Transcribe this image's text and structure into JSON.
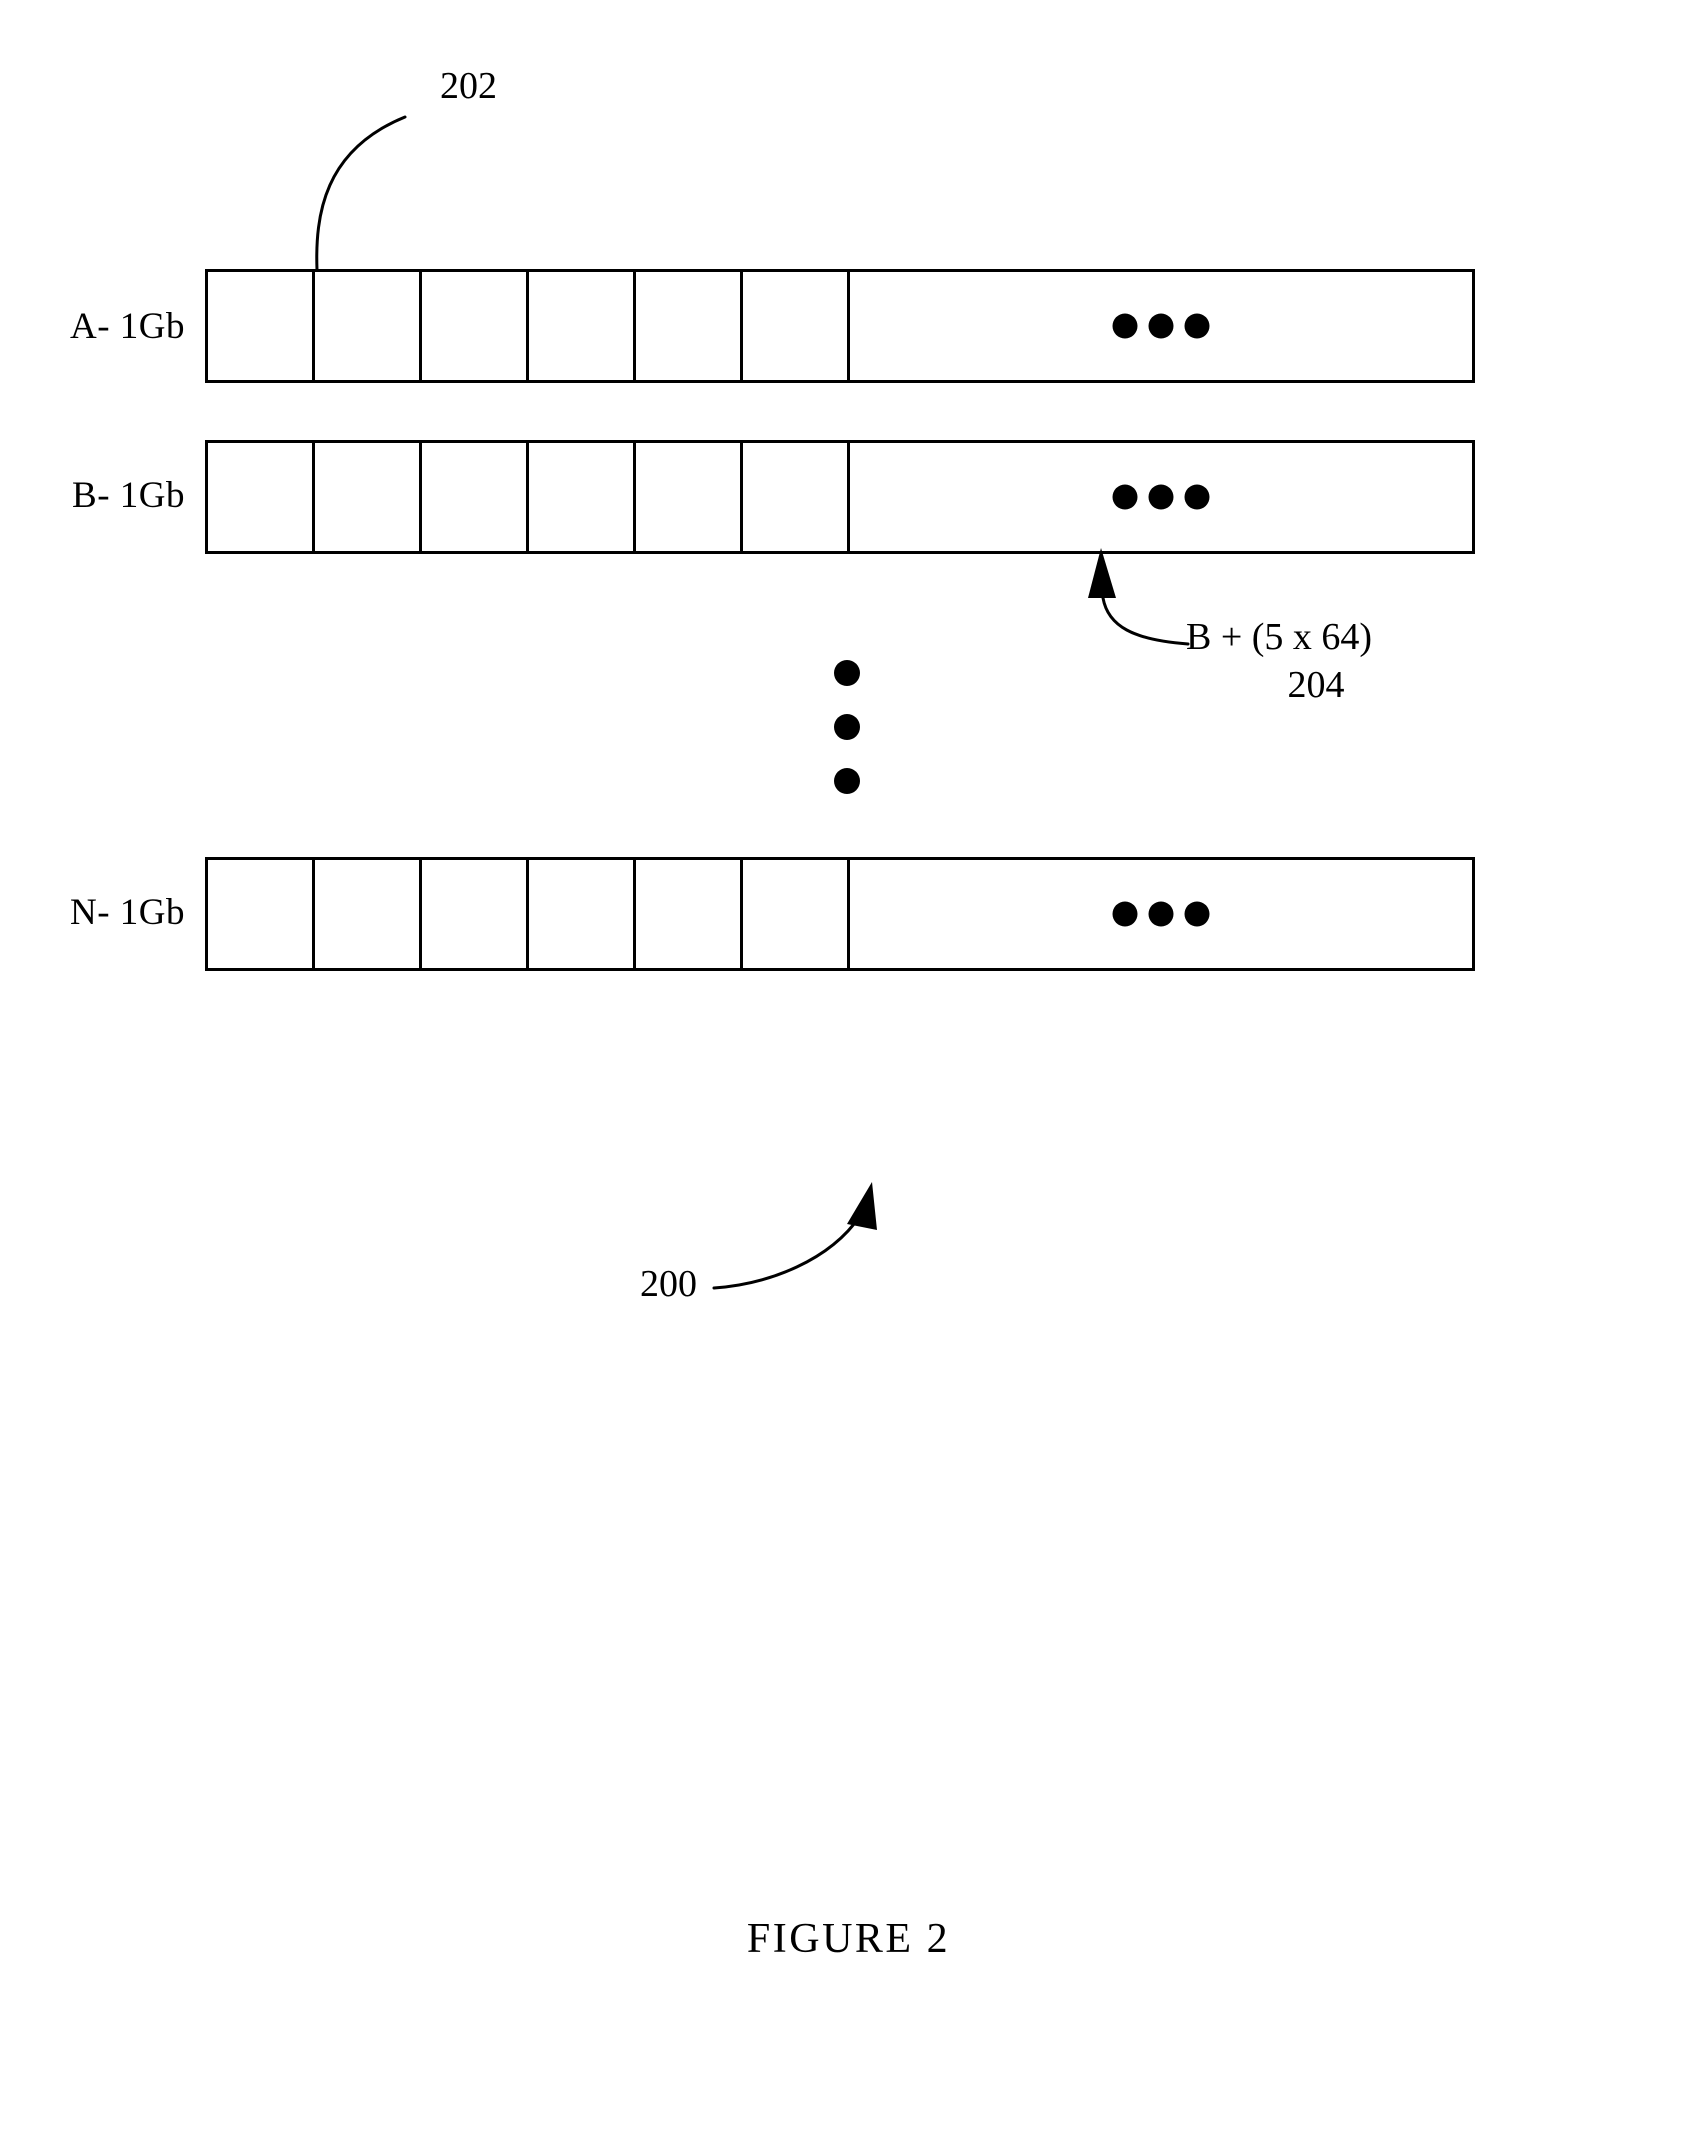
{
  "figure": {
    "caption": "FIGURE 2",
    "number_label": "200"
  },
  "diagram": {
    "rows": [
      {
        "label": "A- 1Gb",
        "cells": 6,
        "ellipsis_cell": true,
        "ellipsis_dots": 3
      },
      {
        "label": "B- 1Gb",
        "cells": 6,
        "ellipsis_cell": true,
        "ellipsis_dots": 3
      },
      {
        "label": "N- 1Gb",
        "cells": 6,
        "ellipsis_cell": true,
        "ellipsis_dots": 3
      }
    ],
    "vertical_ellipsis_dots": 3,
    "annotations": [
      {
        "id": "cell-callout",
        "text": "202",
        "points_to": "first-cell-of-row-A"
      },
      {
        "id": "offset-callout",
        "text": "B + (5 x 64)",
        "sub_text": "204",
        "points_to": "sixth-cell-of-row-B"
      },
      {
        "id": "system-callout",
        "text": "200",
        "points_to": "overall-diagram"
      }
    ]
  },
  "colors": {
    "line": "#000000",
    "background": "#ffffff"
  }
}
